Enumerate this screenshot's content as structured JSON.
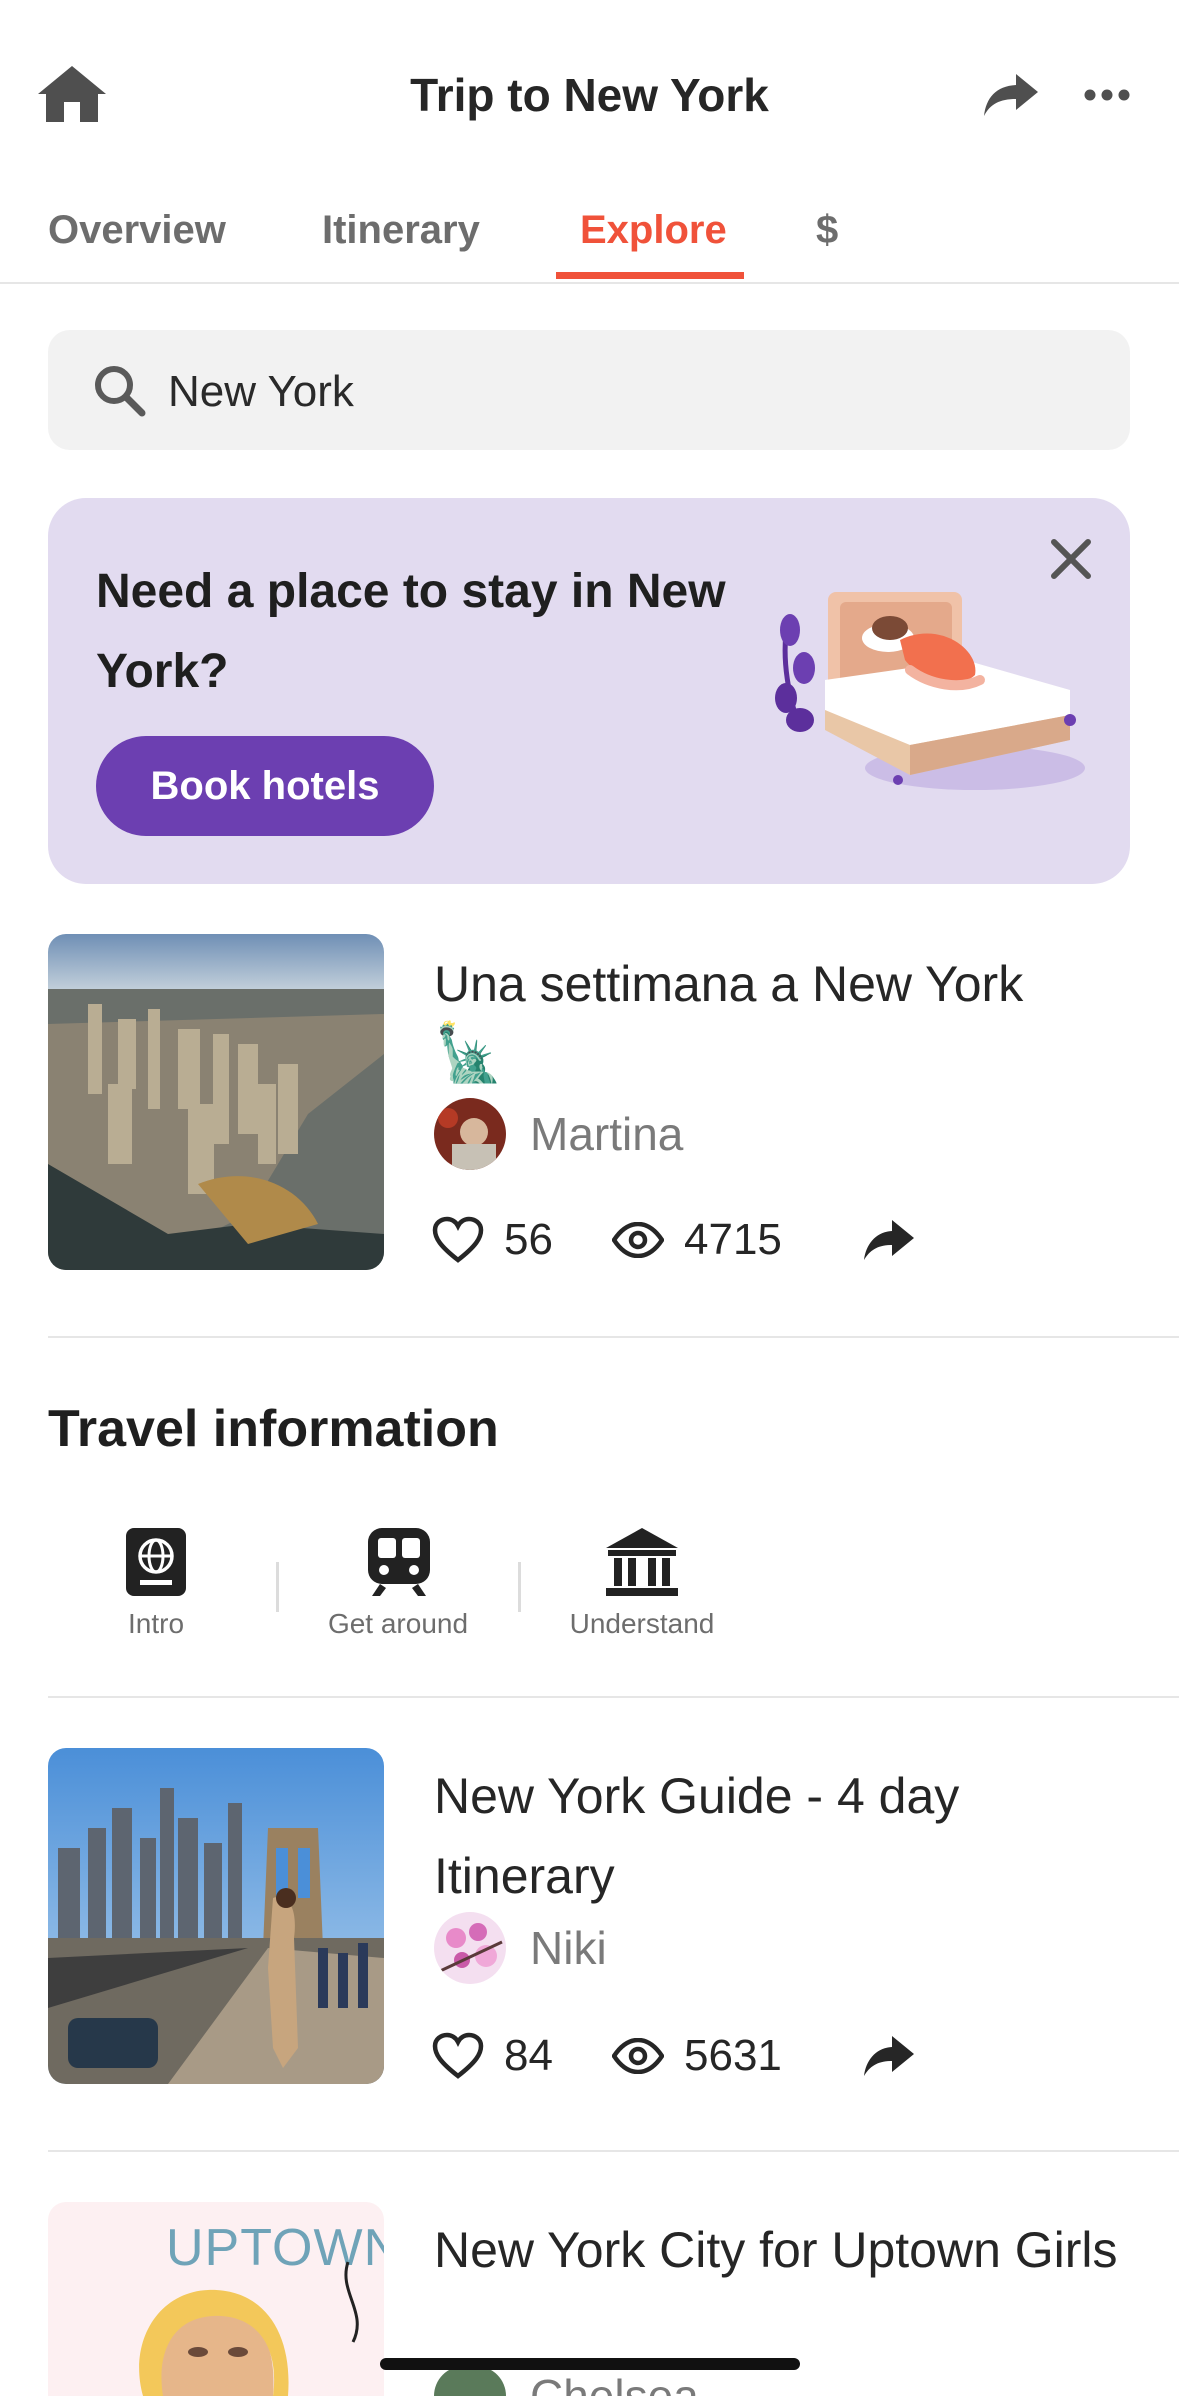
{
  "header": {
    "title": "Trip to New York",
    "home_icon": "home-icon",
    "share_icon": "share-icon",
    "more_icon": "more-icon"
  },
  "tabs": [
    {
      "label": "Overview",
      "active": false
    },
    {
      "label": "Itinerary",
      "active": false
    },
    {
      "label": "Explore",
      "active": true
    },
    {
      "label": "$",
      "active": false
    }
  ],
  "search": {
    "value": "New York",
    "icon": "search-icon"
  },
  "promo": {
    "text": "Need a place to stay in New York?",
    "button_label": "Book hotels",
    "close_icon": "close-icon",
    "illustration": "bed-illustration"
  },
  "trips": [
    {
      "title": "Una settimana a New York",
      "emoji": "🗽",
      "author": "Martina",
      "likes": "56",
      "views": "4715"
    },
    {
      "title": "New York Guide - 4 day Itinerary",
      "author": "Niki",
      "likes": "84",
      "views": "5631"
    },
    {
      "title": "New York City for Uptown Girls",
      "author": "Chelsea",
      "thumb_text": "UPTOWN"
    }
  ],
  "travel_info": {
    "title": "Travel information",
    "items": [
      {
        "label": "Intro",
        "icon": "passport-icon"
      },
      {
        "label": "Get around",
        "icon": "train-icon"
      },
      {
        "label": "Understand",
        "icon": "museum-icon"
      }
    ]
  },
  "colors": {
    "accent": "#f0523a",
    "promo_bg": "#e2dbf0",
    "button": "#6c3fb1"
  }
}
